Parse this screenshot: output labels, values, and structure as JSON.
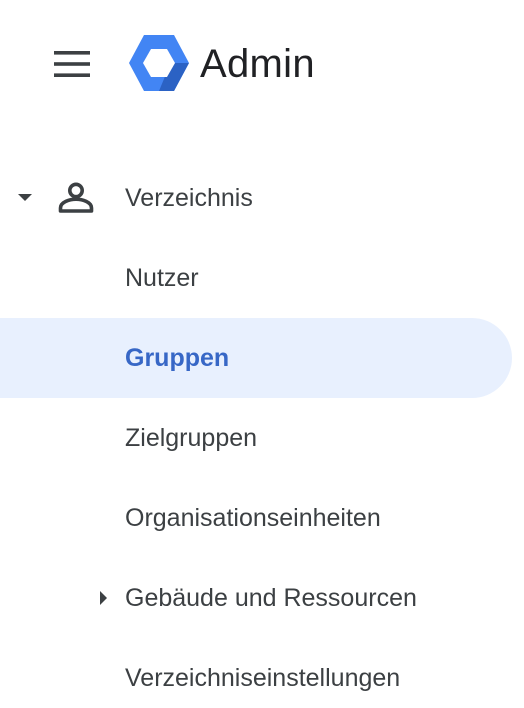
{
  "header": {
    "menu_icon": "hamburger-menu-icon",
    "logo_icon": "google-admin-logo",
    "title": "Admin"
  },
  "colors": {
    "selected_background": "#e8f0fe",
    "selected_text": "#3767c6",
    "text": "#3c4043",
    "logo_blue": "#4285f4",
    "logo_dark_blue": "#2b62c4"
  },
  "nav": {
    "section": {
      "label": "Verzeichnis",
      "icon": "person-icon",
      "expanded": true
    },
    "items": [
      {
        "label": "Nutzer",
        "selected": false
      },
      {
        "label": "Gruppen",
        "selected": true
      },
      {
        "label": "Zielgruppen",
        "selected": false
      },
      {
        "label": "Organisationseinheiten",
        "selected": false
      },
      {
        "label": "Gebäude und Ressourcen",
        "selected": false,
        "expandable": true
      },
      {
        "label": "Verzeichniseinstellungen",
        "selected": false
      }
    ]
  }
}
